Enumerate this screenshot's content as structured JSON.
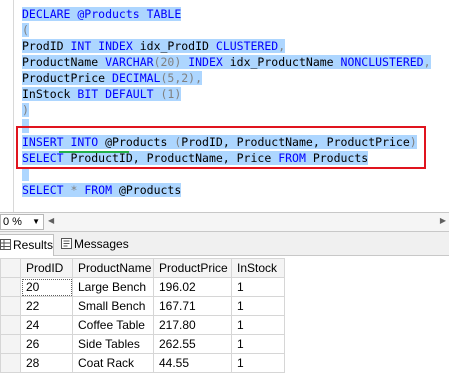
{
  "editor": {
    "lines": [
      {
        "segments": [
          {
            "t": "DECLARE @Products TABLE",
            "c": "kw"
          }
        ]
      },
      {
        "segments": [
          {
            "t": "(",
            "c": "gr"
          }
        ]
      },
      {
        "segments": [
          {
            "t": "ProdID ",
            "c": ""
          },
          {
            "t": "INT INDEX ",
            "c": "kw"
          },
          {
            "t": "idx_ProdID ",
            "c": ""
          },
          {
            "t": "CLUSTERED",
            "c": "kw"
          },
          {
            "t": ",",
            "c": "gr"
          }
        ]
      },
      {
        "segments": [
          {
            "t": "ProductName ",
            "c": ""
          },
          {
            "t": "VARCHAR",
            "c": "kw"
          },
          {
            "t": "(20) ",
            "c": "gr"
          },
          {
            "t": "INDEX ",
            "c": "kw"
          },
          {
            "t": "idx_ProductName ",
            "c": ""
          },
          {
            "t": "NONCLUSTERED",
            "c": "kw"
          },
          {
            "t": ",",
            "c": "gr"
          }
        ]
      },
      {
        "segments": [
          {
            "t": "ProductPrice ",
            "c": ""
          },
          {
            "t": "DECIMAL",
            "c": "kw"
          },
          {
            "t": "(5,2),",
            "c": "gr"
          }
        ]
      },
      {
        "segments": [
          {
            "t": "InStock ",
            "c": ""
          },
          {
            "t": "BIT DEFAULT ",
            "c": "kw"
          },
          {
            "t": "(1)",
            "c": "gr"
          }
        ]
      },
      {
        "segments": [
          {
            "t": ")",
            "c": "gr"
          }
        ]
      },
      {
        "segments": []
      },
      {
        "segments": [
          {
            "t": "INSERT INTO ",
            "c": "kw"
          },
          {
            "t": "@Products ",
            "c": ""
          },
          {
            "t": "(",
            "c": "gr"
          },
          {
            "t": "ProdID, ProductName, ProductPrice",
            "c": ""
          },
          {
            "t": ")",
            "c": "gr"
          }
        ]
      },
      {
        "segments": [
          {
            "t": "SELECT ",
            "c": "kw"
          },
          {
            "t": "ProductID, ProductName, Price ",
            "c": ""
          },
          {
            "t": "FROM ",
            "c": "kw"
          },
          {
            "t": "Products",
            "c": ""
          }
        ]
      },
      {
        "segments": []
      },
      {
        "segments": [
          {
            "t": "SELECT ",
            "c": "kw"
          },
          {
            "t": "* ",
            "c": "gr"
          },
          {
            "t": "FROM ",
            "c": "kw"
          },
          {
            "t": "@Products",
            "c": ""
          }
        ]
      }
    ]
  },
  "zoom": {
    "value": "0 %"
  },
  "tabs": {
    "results": "Results",
    "messages": "Messages"
  },
  "results": {
    "columns": [
      "ProdID",
      "ProductName",
      "ProductPrice",
      "InStock"
    ],
    "rows": [
      [
        "20",
        "Large Bench",
        "196.02",
        "1"
      ],
      [
        "22",
        "Small Bench",
        "167.71",
        "1"
      ],
      [
        "24",
        "Coffee Table",
        "217.80",
        "1"
      ],
      [
        "26",
        "Side Tables",
        "262.55",
        "1"
      ],
      [
        "28",
        "Coat Rack",
        "44.55",
        "1"
      ]
    ]
  },
  "colors": {
    "selection": "#add6ff",
    "keyword": "#0000ff",
    "highlight_box": "#e0141e",
    "squiggle": "#22b14c"
  }
}
